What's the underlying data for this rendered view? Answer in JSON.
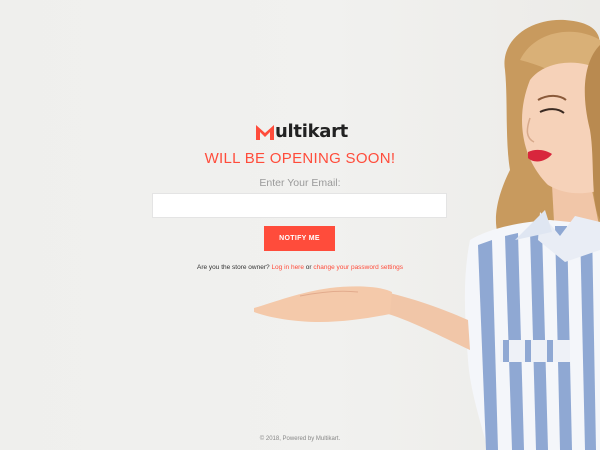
{
  "brand": {
    "logo_text_m": "M",
    "logo_text_rest_1": "ulti",
    "logo_text_rest_2": "kart",
    "accent_color": "#ff4c3b"
  },
  "main": {
    "headline": "WILL BE OPENING SOON!",
    "email_label": "Enter Your Email:",
    "email_value": "",
    "notify_button": "NOTIFY ME",
    "owner_prompt": "Are you the store owner?",
    "login_link": "Log in here",
    "or_text": "or",
    "password_link": "change your password settings"
  },
  "footer": {
    "copyright": "© 2018, Powered by Multikart."
  }
}
